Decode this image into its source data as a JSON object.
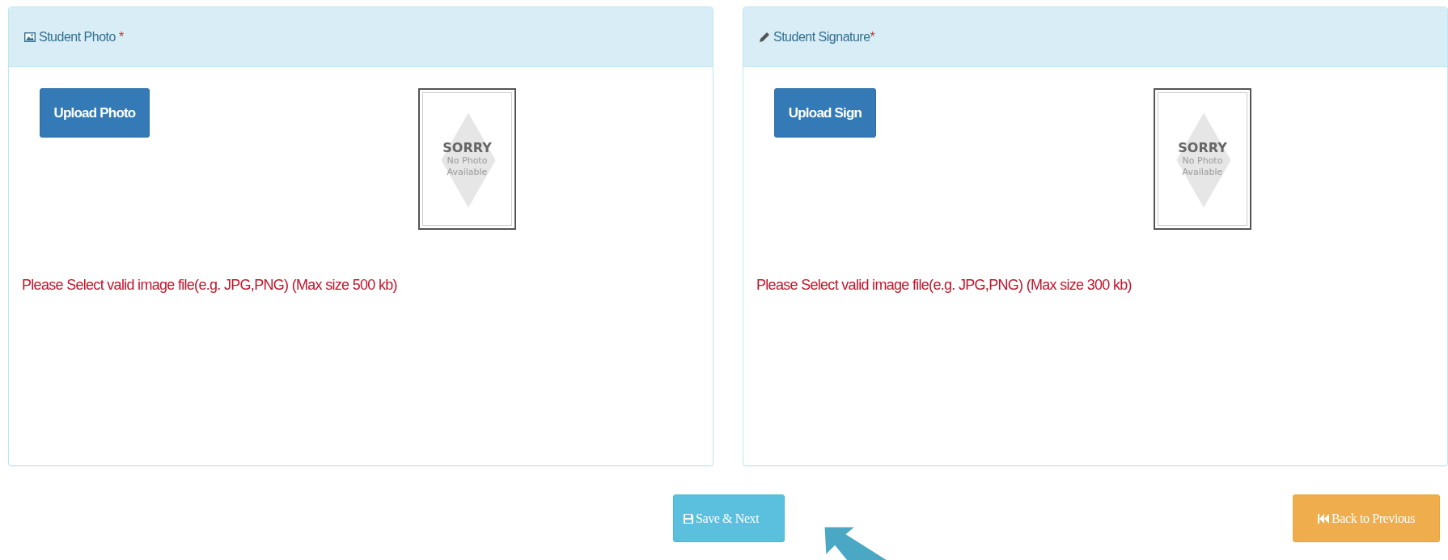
{
  "panels": [
    {
      "kind": "photo",
      "title": "Student Photo",
      "required_mark": "*",
      "upload_button": "Upload Photo",
      "preview": {
        "line_1": "SORRY",
        "line_2": "No Photo",
        "line_3": "Available"
      },
      "hint": "Please Select valid image file(e.g. JPG,PNG) (Max size 500 kb)"
    },
    {
      "kind": "signature",
      "title": "Student Signature",
      "required_mark": "*",
      "upload_button": "Upload Sign",
      "preview": {
        "line_1": "SORRY",
        "line_2": "No Photo",
        "line_3": "Available"
      },
      "hint": "Please Select valid image file(e.g. JPG,PNG) (Max size 300 kb)"
    }
  ],
  "actions": [
    {
      "kind": "save",
      "label": "Save & Next"
    },
    {
      "kind": "back",
      "label": "Back to Previous"
    }
  ]
}
